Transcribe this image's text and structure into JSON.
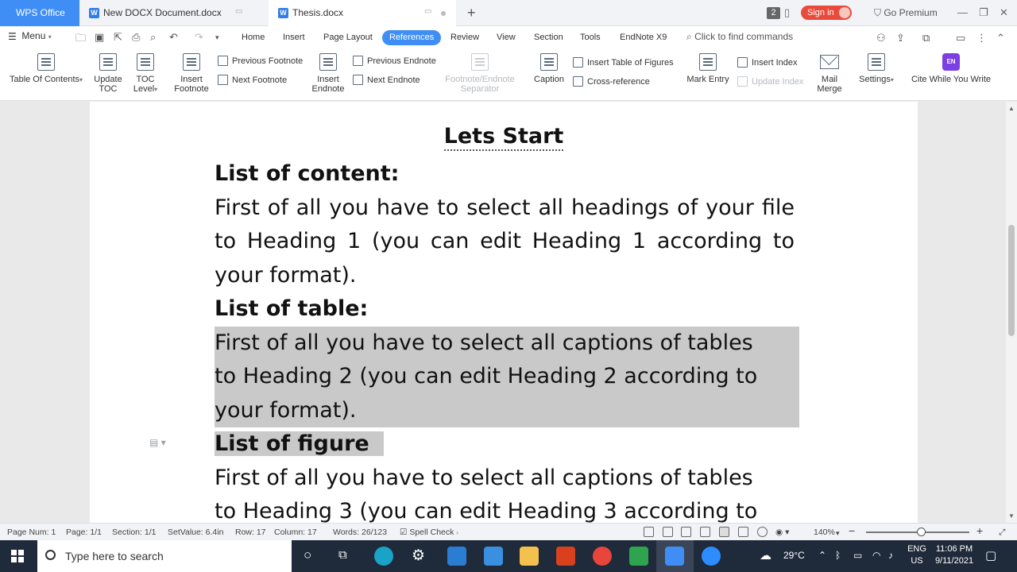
{
  "titlebar": {
    "app_tab": "WPS Office",
    "doc_tabs": [
      {
        "label": "New DOCX Document.docx"
      },
      {
        "label": "Thesis.docx"
      }
    ],
    "count_badge": "2",
    "signin": "Sign in",
    "premium": "Go Premium"
  },
  "menu": {
    "menu_label": "Menu",
    "tabs": [
      "Home",
      "Insert",
      "Page Layout",
      "References",
      "Review",
      "View",
      "Section",
      "Tools",
      "EndNote X9"
    ],
    "active_tab": "References",
    "find_commands": "Click to find commands"
  },
  "ribbon": {
    "toc": "Table Of Contents",
    "update_toc_1": "Update",
    "update_toc_2": "TOC",
    "toc_level_1": "TOC",
    "toc_level_2": "Level",
    "insert_footnote_1": "Insert",
    "insert_footnote_2": "Footnote",
    "prev_footnote": "Previous Footnote",
    "next_footnote": "Next Footnote",
    "insert_endnote_1": "Insert",
    "insert_endnote_2": "Endnote",
    "prev_endnote": "Previous Endnote",
    "next_endnote": "Next Endnote",
    "separator_1": "Footnote/Endnote",
    "separator_2": "Separator",
    "caption": "Caption",
    "insert_tof": "Insert Table of Figures",
    "cross_ref": "Cross-reference",
    "mark_entry": "Mark Entry",
    "insert_index": "Insert Index",
    "update_index": "Update Index",
    "mail_merge_1": "Mail",
    "mail_merge_2": "Merge",
    "settings": "Settings",
    "cite_while": "Cite While You Write",
    "en_icon": "EN"
  },
  "document": {
    "title": "Lets Start",
    "h1": "List of content:",
    "p1": "First of all you have to select all headings of your file to Heading 1 (you can edit Heading 1 according to your format).",
    "h2": "List of table:",
    "p2_l1": "First of all you have to select all captions of tables",
    "p2_l2": "to Heading 2 (you can edit Heading 2 according to",
    "p2_l3": "your format).",
    "h3": "List of figure",
    "p3_l1": "First of all you have to select all captions of tables",
    "p3_l2": "to Heading 3 (you can edit Heading 3 according to"
  },
  "status": {
    "page_num": "Page Num: 1",
    "page": "Page: 1/1",
    "section": "Section: 1/1",
    "setvalue": "SetValue: 6.4in",
    "row": "Row: 17",
    "column": "Column: 17",
    "words": "Words: 26/123",
    "spell": "Spell Check",
    "zoom": "140%"
  },
  "taskbar": {
    "search_placeholder": "Type here to search",
    "weather": "29°C",
    "lang_1": "ENG",
    "lang_2": "US",
    "time": "11:06 PM",
    "date": "9/11/2021"
  },
  "colors": {
    "accent": "#3f8ef5",
    "signin": "#e84b3c",
    "selection": "#c9c9c9",
    "taskbar": "#1f2a3a"
  }
}
